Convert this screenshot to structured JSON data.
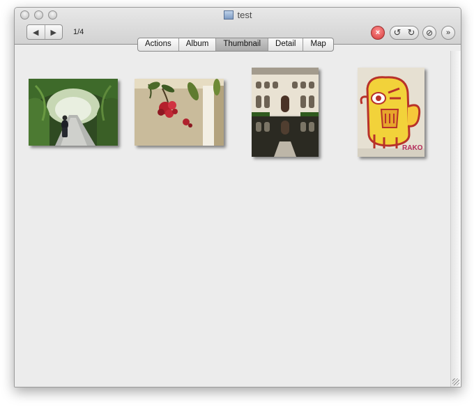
{
  "window": {
    "title": "test"
  },
  "toolbar": {
    "back_symbol": "◀",
    "forward_symbol": "▶",
    "counter": "1/4",
    "stop_symbol": "×",
    "rotate_left_symbol": "↺",
    "rotate_right_symbol": "↻",
    "compass_symbol": "⊘",
    "more_symbol": "»"
  },
  "tabs": [
    {
      "label": "Actions"
    },
    {
      "label": "Album"
    },
    {
      "label": "Thumbnail",
      "selected": true
    },
    {
      "label": "Detail"
    },
    {
      "label": "Map"
    }
  ],
  "thumbnails": [
    {
      "name": "garden-arch-walkway"
    },
    {
      "name": "red-flowers"
    },
    {
      "name": "alhambra-courtyard-pool"
    },
    {
      "name": "graffiti-robot"
    }
  ],
  "graffiti_tag": "RAKO"
}
